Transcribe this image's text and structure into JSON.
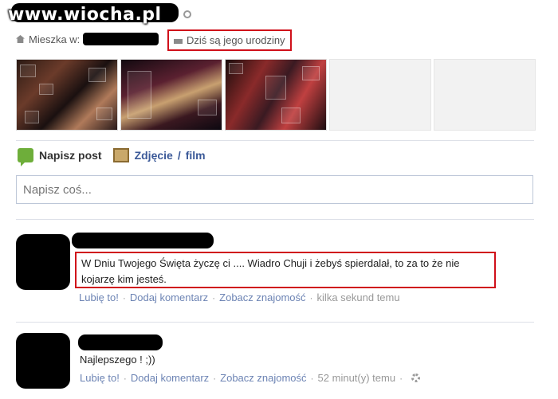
{
  "watermark": "www.wiocha.pl",
  "profile": {
    "location_label": "Mieszka w:",
    "birthday_text": "Dziś są jego urodziny"
  },
  "composer": {
    "post_tab": "Napisz post",
    "media_tab": "Zdjęcie",
    "media_separator": "/",
    "media_tab_2": "film",
    "input_placeholder": "Napisz coś..."
  },
  "posts": [
    {
      "text": "W Dniu Twojego Święta życzę ci .... Wiadro Chuji i żebyś spierdalał, to za to że nie kojarzę kim jesteś.",
      "like": "Lubię to!",
      "comment": "Dodaj komentarz",
      "friendship": "Zobacz znajomość",
      "time": "kilka sekund temu"
    },
    {
      "text": "Najlepszego ! ;))",
      "like": "Lubię to!",
      "comment": "Dodaj komentarz",
      "friendship": "Zobacz znajomość",
      "time": "52 minut(y) temu"
    }
  ],
  "colors": {
    "link": "#6d84b4",
    "highlight": "#d0101a",
    "brand": "#3b5998"
  }
}
